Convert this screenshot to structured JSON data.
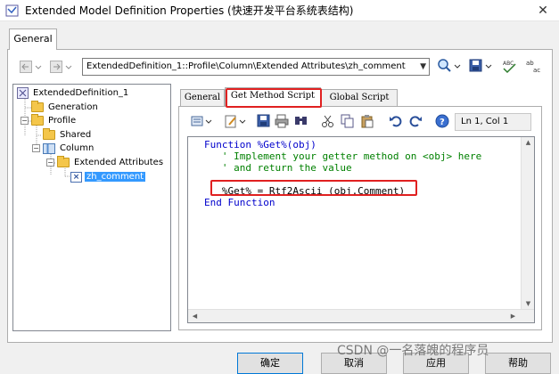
{
  "window": {
    "title": "Extended Model Definition Properties (快速开发平台系统表结构)"
  },
  "outer_tabs": [
    "General"
  ],
  "path": {
    "value": "ExtendedDefinition_1::Profile\\Column\\Extended Attributes\\zh_comment"
  },
  "tree": {
    "items": [
      {
        "label": "ExtendedDefinition_1"
      },
      {
        "label": "Generation"
      },
      {
        "label": "Profile"
      },
      {
        "label": "Shared"
      },
      {
        "label": "Column"
      },
      {
        "label": "Extended Attributes"
      },
      {
        "label": "zh_comment"
      }
    ]
  },
  "inner_tabs": [
    "General",
    "Get Method Script",
    "Global Script"
  ],
  "editor": {
    "position": "Ln 1, Col 1",
    "lines": [
      "Function %Get%(obj)",
      "   ' Implement your getter method on <obj> here",
      "   ' and return the value",
      "",
      "   %Get% = Rtf2Ascii (obj.Comment)",
      "End Function"
    ]
  },
  "buttons": {
    "ok": "确定",
    "cancel": "取消",
    "apply": "应用",
    "help": "帮助"
  },
  "watermark": "CSDN @一名落魄的程序员",
  "colors": {
    "highlight": "#e02020",
    "selection": "#3399ff",
    "keyword": "#0000cc",
    "comment": "#008000"
  }
}
